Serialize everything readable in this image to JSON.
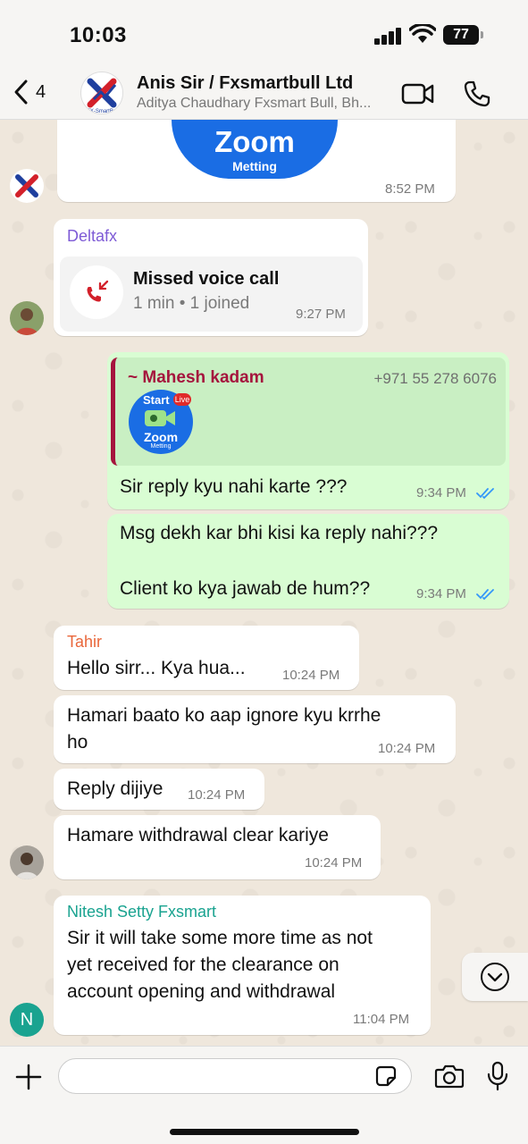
{
  "status_bar": {
    "time": "10:03",
    "battery": "77"
  },
  "header": {
    "back_count": "4",
    "title": "Anis Sir / Fxsmartbull Ltd",
    "subtitle": "Aditya Chaudhary Fxsmart Bull, Bh...",
    "logo_text": "FX-SmartBull"
  },
  "messages": [
    {
      "zoom_title": "Zoom",
      "zoom_sub": "Metting",
      "time": "8:52 PM"
    },
    {
      "sender": "Deltafx",
      "call_title": "Missed voice call",
      "call_detail": "1 min • 1 joined",
      "time": "9:27 PM"
    },
    {
      "quote_author": "~ Mahesh kadam",
      "quote_phone": "+971 55 278 6076",
      "thumb_top": "Start",
      "thumb_badge": "Live",
      "thumb_title": "Zoom",
      "thumb_sub": "Metting",
      "text": "Sir reply kyu nahi karte ???",
      "time": "9:34 PM"
    },
    {
      "line1": "Msg dekh kar bhi kisi ka reply nahi???",
      "line2": "Client ko kya jawab de hum??",
      "time": "9:34 PM"
    },
    {
      "sender": "Tahir",
      "text": "Hello sirr...  Kya hua...",
      "time": "10:24 PM"
    },
    {
      "line1": "Hamari baato ko aap ignore kyu krrhe",
      "line2": "ho",
      "time": "10:24 PM"
    },
    {
      "text": "Reply dijiye",
      "time": "10:24 PM"
    },
    {
      "text": "Hamare withdrawal clear kariye",
      "time": "10:24 PM"
    },
    {
      "sender": "Nitesh Setty Fxsmart",
      "line1": "Sir it will take some more time as  not",
      "line2": "yet received for the clearance on",
      "line3": "account opening and withdrawal",
      "time": "11:04 PM",
      "avatar_letter": "N"
    }
  ],
  "colors": {
    "outgoing": "#d9fdd3",
    "incoming": "#ffffff",
    "tick_blue": "#3497f9",
    "deltafx": "#7e5bd6",
    "tahir": "#e9673b",
    "nitesh": "#1aa390",
    "mahesh": "#a5143d"
  },
  "icons": [
    "back-chevron-icon",
    "video-call-icon",
    "phone-icon",
    "missed-call-icon",
    "double-tick-icon",
    "plus-icon",
    "sticker-icon",
    "camera-icon",
    "microphone-icon",
    "chevron-down-icon"
  ]
}
